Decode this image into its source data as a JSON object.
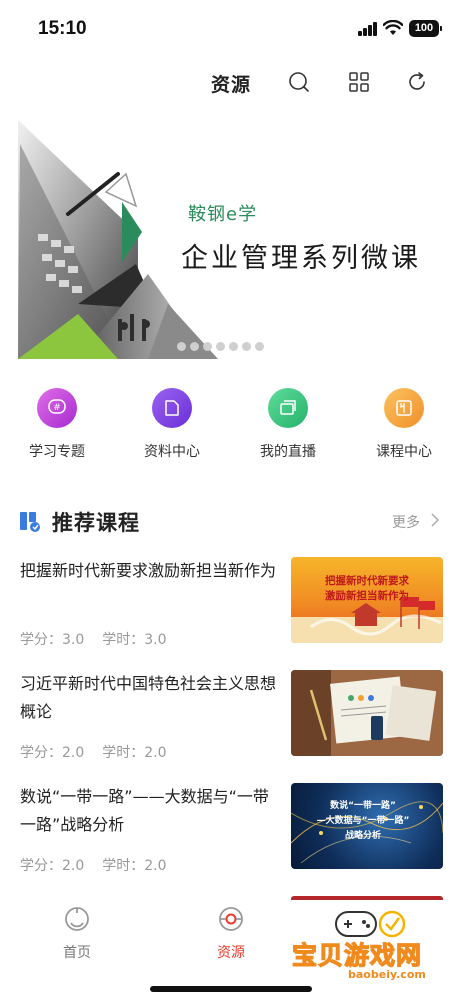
{
  "status_bar": {
    "time": "15:10",
    "battery": "100"
  },
  "header": {
    "title": "资源",
    "icons": [
      "search-icon",
      "grid-icon",
      "refresh-icon"
    ]
  },
  "banner": {
    "subtitle": "鞍钢e学",
    "title": "企业管理系列微课",
    "slide_count": 7,
    "active_slide": 0
  },
  "quick_entries": [
    {
      "label": "学习专题",
      "icon": "hash-chat-icon",
      "color": "#c23ad6"
    },
    {
      "label": "资料中心",
      "icon": "folder-icon",
      "color": "#7b3fe0"
    },
    {
      "label": "我的直播",
      "icon": "live-icon",
      "color": "#2fbf74"
    },
    {
      "label": "课程中心",
      "icon": "book-icon",
      "color": "#f3a433"
    }
  ],
  "section": {
    "title": "推荐课程",
    "more": "更多"
  },
  "courses": [
    {
      "title": "把握新时代新要求激励新担当新作为",
      "credit": "学分：3.0",
      "hours": "学时：3.0",
      "thumb_text": "把握新时代新要求\n激励新担当新作为",
      "thumb_line1": "把握新时代新要求",
      "thumb_line2": "激励新担当新作为"
    },
    {
      "title": "习近平新时代中国特色社会主义思想概论",
      "credit": "学分：2.0",
      "hours": "学时：2.0"
    },
    {
      "title": "数说“一带一路”——大数据与“一带一路”战略分析",
      "credit": "学分：2.0",
      "hours": "学时：2.0",
      "thumb_line1": "数说“一带一路”",
      "thumb_line2": "—大数据与“一带一路”",
      "thumb_line3": "战略分析"
    }
  ],
  "tabs": [
    {
      "label": "首页",
      "active": false
    },
    {
      "label": "资源",
      "active": true
    }
  ],
  "watermark": {
    "text": "宝贝游戏网",
    "url": "baobeiy.com"
  },
  "colors": {
    "accent": "#e83b2b",
    "green": "#2a8c5c",
    "muted": "#999999"
  }
}
